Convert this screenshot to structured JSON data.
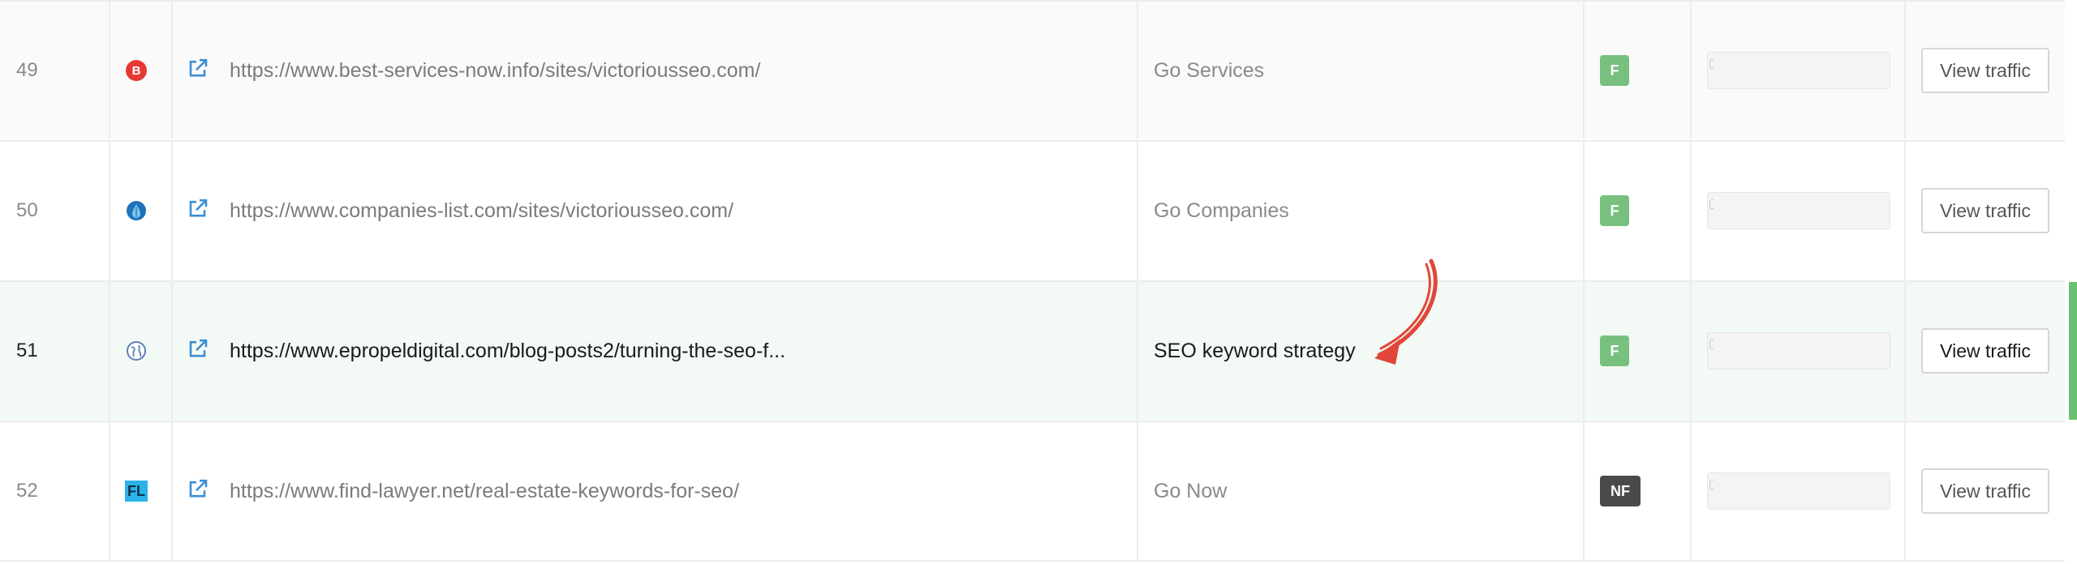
{
  "rows": [
    {
      "num": "49",
      "favicon": "b-red-circle-icon",
      "url": "https://www.best-services-now.info/sites/victoriousseo.com/",
      "anchor": "Go Services",
      "badge": "F",
      "button": "View traffic"
    },
    {
      "num": "50",
      "favicon": "blue-drop-circle-icon",
      "url": "https://www.companies-list.com/sites/victoriousseo.com/",
      "anchor": "Go Companies",
      "badge": "F",
      "button": "View traffic"
    },
    {
      "num": "51",
      "favicon": "globe-icon",
      "url": "https://www.epropeldigital.com/blog-posts2/turning-the-seo-f...",
      "anchor": "SEO keyword strategy",
      "badge": "F",
      "button": "View traffic",
      "highlighted": true
    },
    {
      "num": "52",
      "favicon": "fl-logo-icon",
      "favicon_text": "FL",
      "url": "https://www.find-lawyer.net/real-estate-keywords-for-seo/",
      "anchor": "Go Now",
      "badge": "NF",
      "button": "View traffic"
    }
  ],
  "colors": {
    "follow_badge": "#78c07e",
    "nofollow_badge": "#4a4a4a",
    "highlight_bar": "#6cc071",
    "annotation_arrow": "#e0473a",
    "link_icon": "#3a8fd6"
  }
}
